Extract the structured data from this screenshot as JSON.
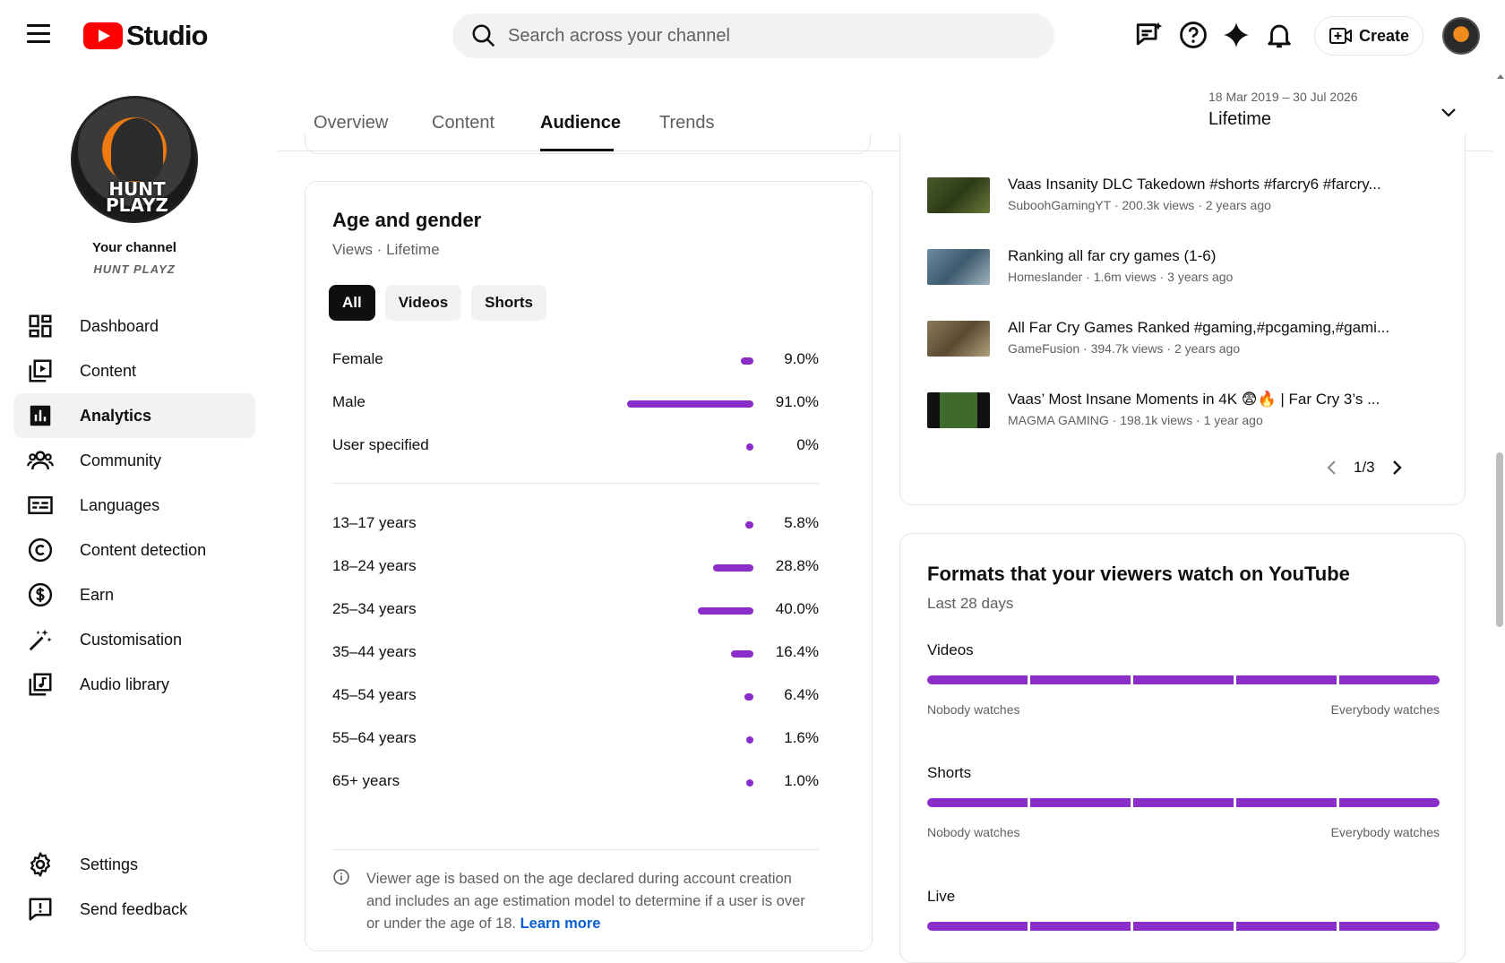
{
  "app": {
    "logo_text": "Studio"
  },
  "search": {
    "placeholder": "Search across your channel"
  },
  "header": {
    "create_label": "Create"
  },
  "sidebar": {
    "your_channel": "Your channel",
    "channel_name": "HUNT PLAYZ",
    "avatar_text": "HUNT PLAYZ",
    "items": [
      {
        "label": "Dashboard",
        "icon": "dashboard-icon"
      },
      {
        "label": "Content",
        "icon": "content-icon"
      },
      {
        "label": "Analytics",
        "icon": "analytics-icon",
        "active": true
      },
      {
        "label": "Community",
        "icon": "community-icon"
      },
      {
        "label": "Languages",
        "icon": "languages-icon"
      },
      {
        "label": "Content detection",
        "icon": "copyright-icon"
      },
      {
        "label": "Earn",
        "icon": "earn-icon"
      },
      {
        "label": "Customisation",
        "icon": "magic-wand-icon"
      },
      {
        "label": "Audio library",
        "icon": "audio-library-icon"
      }
    ],
    "bottom_items": [
      {
        "label": "Settings",
        "icon": "gear-icon"
      },
      {
        "label": "Send feedback",
        "icon": "feedback-icon"
      }
    ]
  },
  "tabs": [
    "Overview",
    "Content",
    "Audience",
    "Trends"
  ],
  "active_tab": "Audience",
  "date_range": {
    "range": "18 Mar 2019 – 30 Jul 2026",
    "label": "Lifetime"
  },
  "age_gender": {
    "title": "Age and gender",
    "subtitle": "Views · Lifetime",
    "chips": [
      "All",
      "Videos",
      "Shorts"
    ],
    "active_chip": "All",
    "gender": [
      {
        "label": "Female",
        "value": "9.0%",
        "pct": 9.0
      },
      {
        "label": "Male",
        "value": "91.0%",
        "pct": 91.0
      },
      {
        "label": "User specified",
        "value": "0%",
        "pct": 0
      }
    ],
    "ages": [
      {
        "label": "13–17 years",
        "value": "5.8%",
        "pct": 5.8
      },
      {
        "label": "18–24 years",
        "value": "28.8%",
        "pct": 28.8
      },
      {
        "label": "25–34 years",
        "value": "40.0%",
        "pct": 40.0
      },
      {
        "label": "35–44 years",
        "value": "16.4%",
        "pct": 16.4
      },
      {
        "label": "45–54 years",
        "value": "6.4%",
        "pct": 6.4
      },
      {
        "label": "55–64 years",
        "value": "1.6%",
        "pct": 1.6
      },
      {
        "label": "65+ years",
        "value": "1.0%",
        "pct": 1.0
      }
    ],
    "note": "Viewer age is based on the age declared during account creation and includes an age estimation model to determine if a user is over or under the age of 18.",
    "learn_more": "Learn more"
  },
  "videos": {
    "items": [
      {
        "title": "Vaas Insanity DLC Takedown #shorts #farcry6 #farcry...",
        "meta": "SuboohGamingYT · 200.3k views · 2 years ago"
      },
      {
        "title": "Ranking all far cry games (1-6)",
        "meta": "Homeslander · 1.6m views · 3 years ago"
      },
      {
        "title": "All Far Cry Games Ranked #gaming,#pcgaming,#gami...",
        "meta": "GameFusion · 394.7k views · 2 years ago"
      },
      {
        "title": "Vaas’ Most Insane Moments in 4K 😨🔥 | Far Cry 3’s ...",
        "meta": "MAGMA GAMING · 198.1k views · 1 year ago"
      }
    ],
    "page": "1/3"
  },
  "formats": {
    "title": "Formats that your viewers watch on YouTube",
    "subtitle": "Last 28 days",
    "rows": [
      {
        "label": "Videos",
        "min_label": "Nobody watches",
        "max_label": "Everybody watches"
      },
      {
        "label": "Shorts",
        "min_label": "Nobody watches",
        "max_label": "Everybody watches"
      },
      {
        "label": "Live"
      }
    ]
  },
  "colors": {
    "accent": "#8b2ec9",
    "brand": "#ff0000",
    "link": "#065fd4"
  }
}
